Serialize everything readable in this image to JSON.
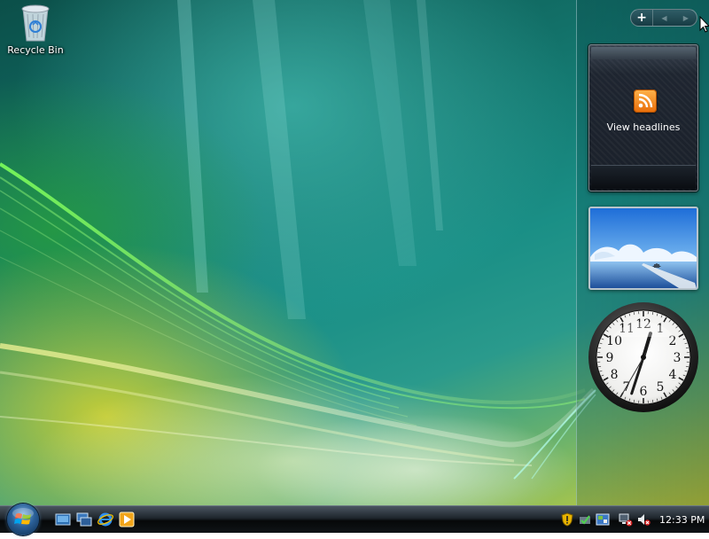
{
  "desktop": {
    "icons": [
      {
        "label": "Recycle Bin",
        "icon": "recycle-bin-icon"
      }
    ]
  },
  "sidebar": {
    "controls": {
      "add": "+",
      "previous": "◀",
      "next": "▶"
    },
    "gadgets": {
      "feed": {
        "label": "View headlines",
        "icon": "rss-feed-icon",
        "accent": "#f08a1c"
      },
      "slideshow": {
        "subject": "ocean pier landscape"
      },
      "clock": {
        "numbers": [
          "12",
          "1",
          "2",
          "3",
          "4",
          "5",
          "6",
          "7",
          "8",
          "9",
          "10",
          "11"
        ],
        "hour": 12,
        "minute": 33,
        "second": 35
      }
    }
  },
  "taskbar": {
    "start_button": "start-orb",
    "quick_launch": [
      "show-desktop-icon",
      "switch-windows-icon",
      "internet-explorer-icon",
      "media-player-icon"
    ],
    "tray_icons": [
      "windows-security-alert-icon",
      "windows-defender-icon",
      "network-icon",
      "network-disconnected-icon",
      "volume-muted-icon"
    ],
    "clock": "12:33 PM"
  },
  "colors": {
    "taskbar": "#0c1114",
    "wallpaper_teal": "#127068",
    "wallpaper_yellow": "#c9cf3a"
  }
}
